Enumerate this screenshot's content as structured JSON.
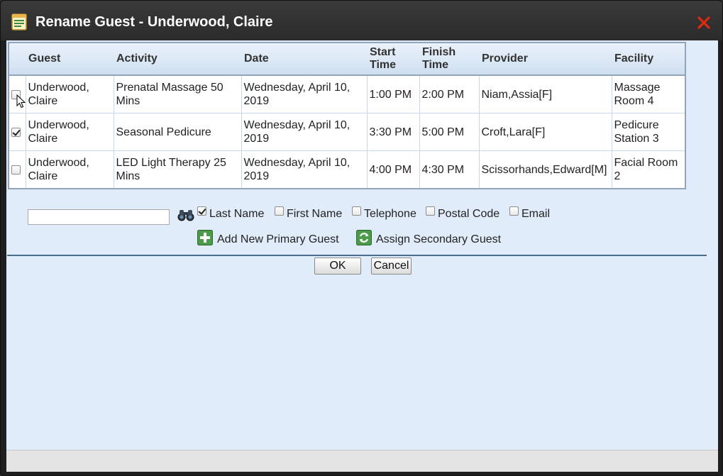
{
  "dialog": {
    "title": "Rename Guest - Underwood, Claire"
  },
  "table": {
    "headers": {
      "guest": "Guest",
      "activity": "Activity",
      "date": "Date",
      "start_time": "Start Time",
      "finish_time": "Finish Time",
      "provider": "Provider",
      "facility": "Facility"
    },
    "rows": [
      {
        "checked": false,
        "guest": "Underwood, Claire",
        "activity": "Prenatal Massage 50 Mins",
        "date": "Wednesday, April 10, 2019",
        "start_time": "1:00 PM",
        "finish_time": "2:00 PM",
        "provider": "Niam,Assia[F]",
        "facility": "Massage Room 4"
      },
      {
        "checked": true,
        "guest": "Underwood, Claire",
        "activity": "Seasonal Pedicure",
        "date": "Wednesday, April 10, 2019",
        "start_time": "3:30 PM",
        "finish_time": "5:00 PM",
        "provider": "Croft,Lara[F]",
        "facility": "Pedicure Station 3"
      },
      {
        "checked": false,
        "guest": "Underwood, Claire",
        "activity": "LED Light Therapy 25 Mins",
        "date": "Wednesday, April 10, 2019",
        "start_time": "4:00 PM",
        "finish_time": "4:30 PM",
        "provider": "Scissorhands,Edward[M]",
        "facility": "Facial Room 2"
      }
    ]
  },
  "search": {
    "value": "",
    "options": {
      "last_name": {
        "label": "Last Name",
        "checked": true
      },
      "first_name": {
        "label": "First Name",
        "checked": false
      },
      "telephone": {
        "label": "Telephone",
        "checked": false
      },
      "postal_code": {
        "label": "Postal Code",
        "checked": false
      },
      "email": {
        "label": "Email",
        "checked": false
      }
    }
  },
  "actions": {
    "add_primary": "Add New Primary Guest",
    "assign_secondary": "Assign Secondary Guest"
  },
  "buttons": {
    "ok": "OK",
    "cancel": "Cancel"
  },
  "colors": {
    "title_bar": "#2b2b2b",
    "panel_bg": "#e1ecfa",
    "close_red": "#e02a10",
    "action_green": "#3f8f3f"
  }
}
